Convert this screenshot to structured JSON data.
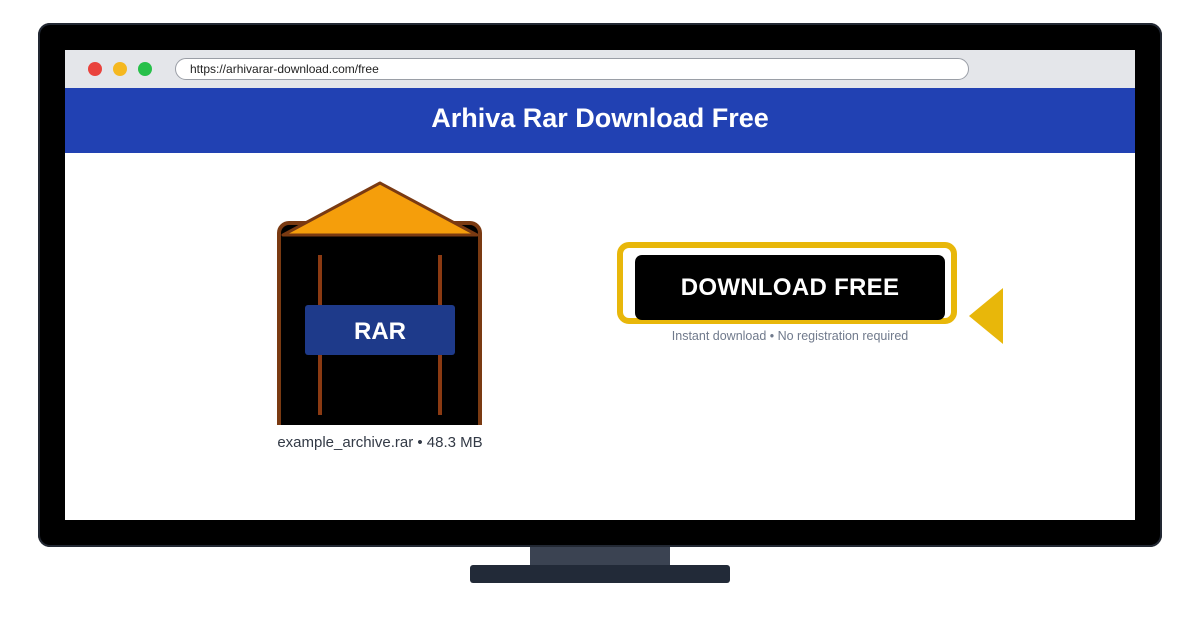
{
  "browser": {
    "url": "https://arhivarar-download.com/free"
  },
  "page": {
    "title": "Arhiva Rar Download Free"
  },
  "archive": {
    "label": "RAR",
    "filename": "example_archive.rar",
    "size": "48.3 MB",
    "caption": "example_archive.rar • 48.3 MB",
    "icon": "rar-archive-icon"
  },
  "download": {
    "button_label": "DOWNLOAD FREE",
    "subtext": "Instant download • No registration required"
  },
  "colors": {
    "header": "#2141b3",
    "archive_accent": "#f59e0b",
    "archive_outline": "#7a3a12",
    "rar_label_bg": "#1e3a8a",
    "highlight": "#e8b70a",
    "button_bg": "#000000"
  }
}
